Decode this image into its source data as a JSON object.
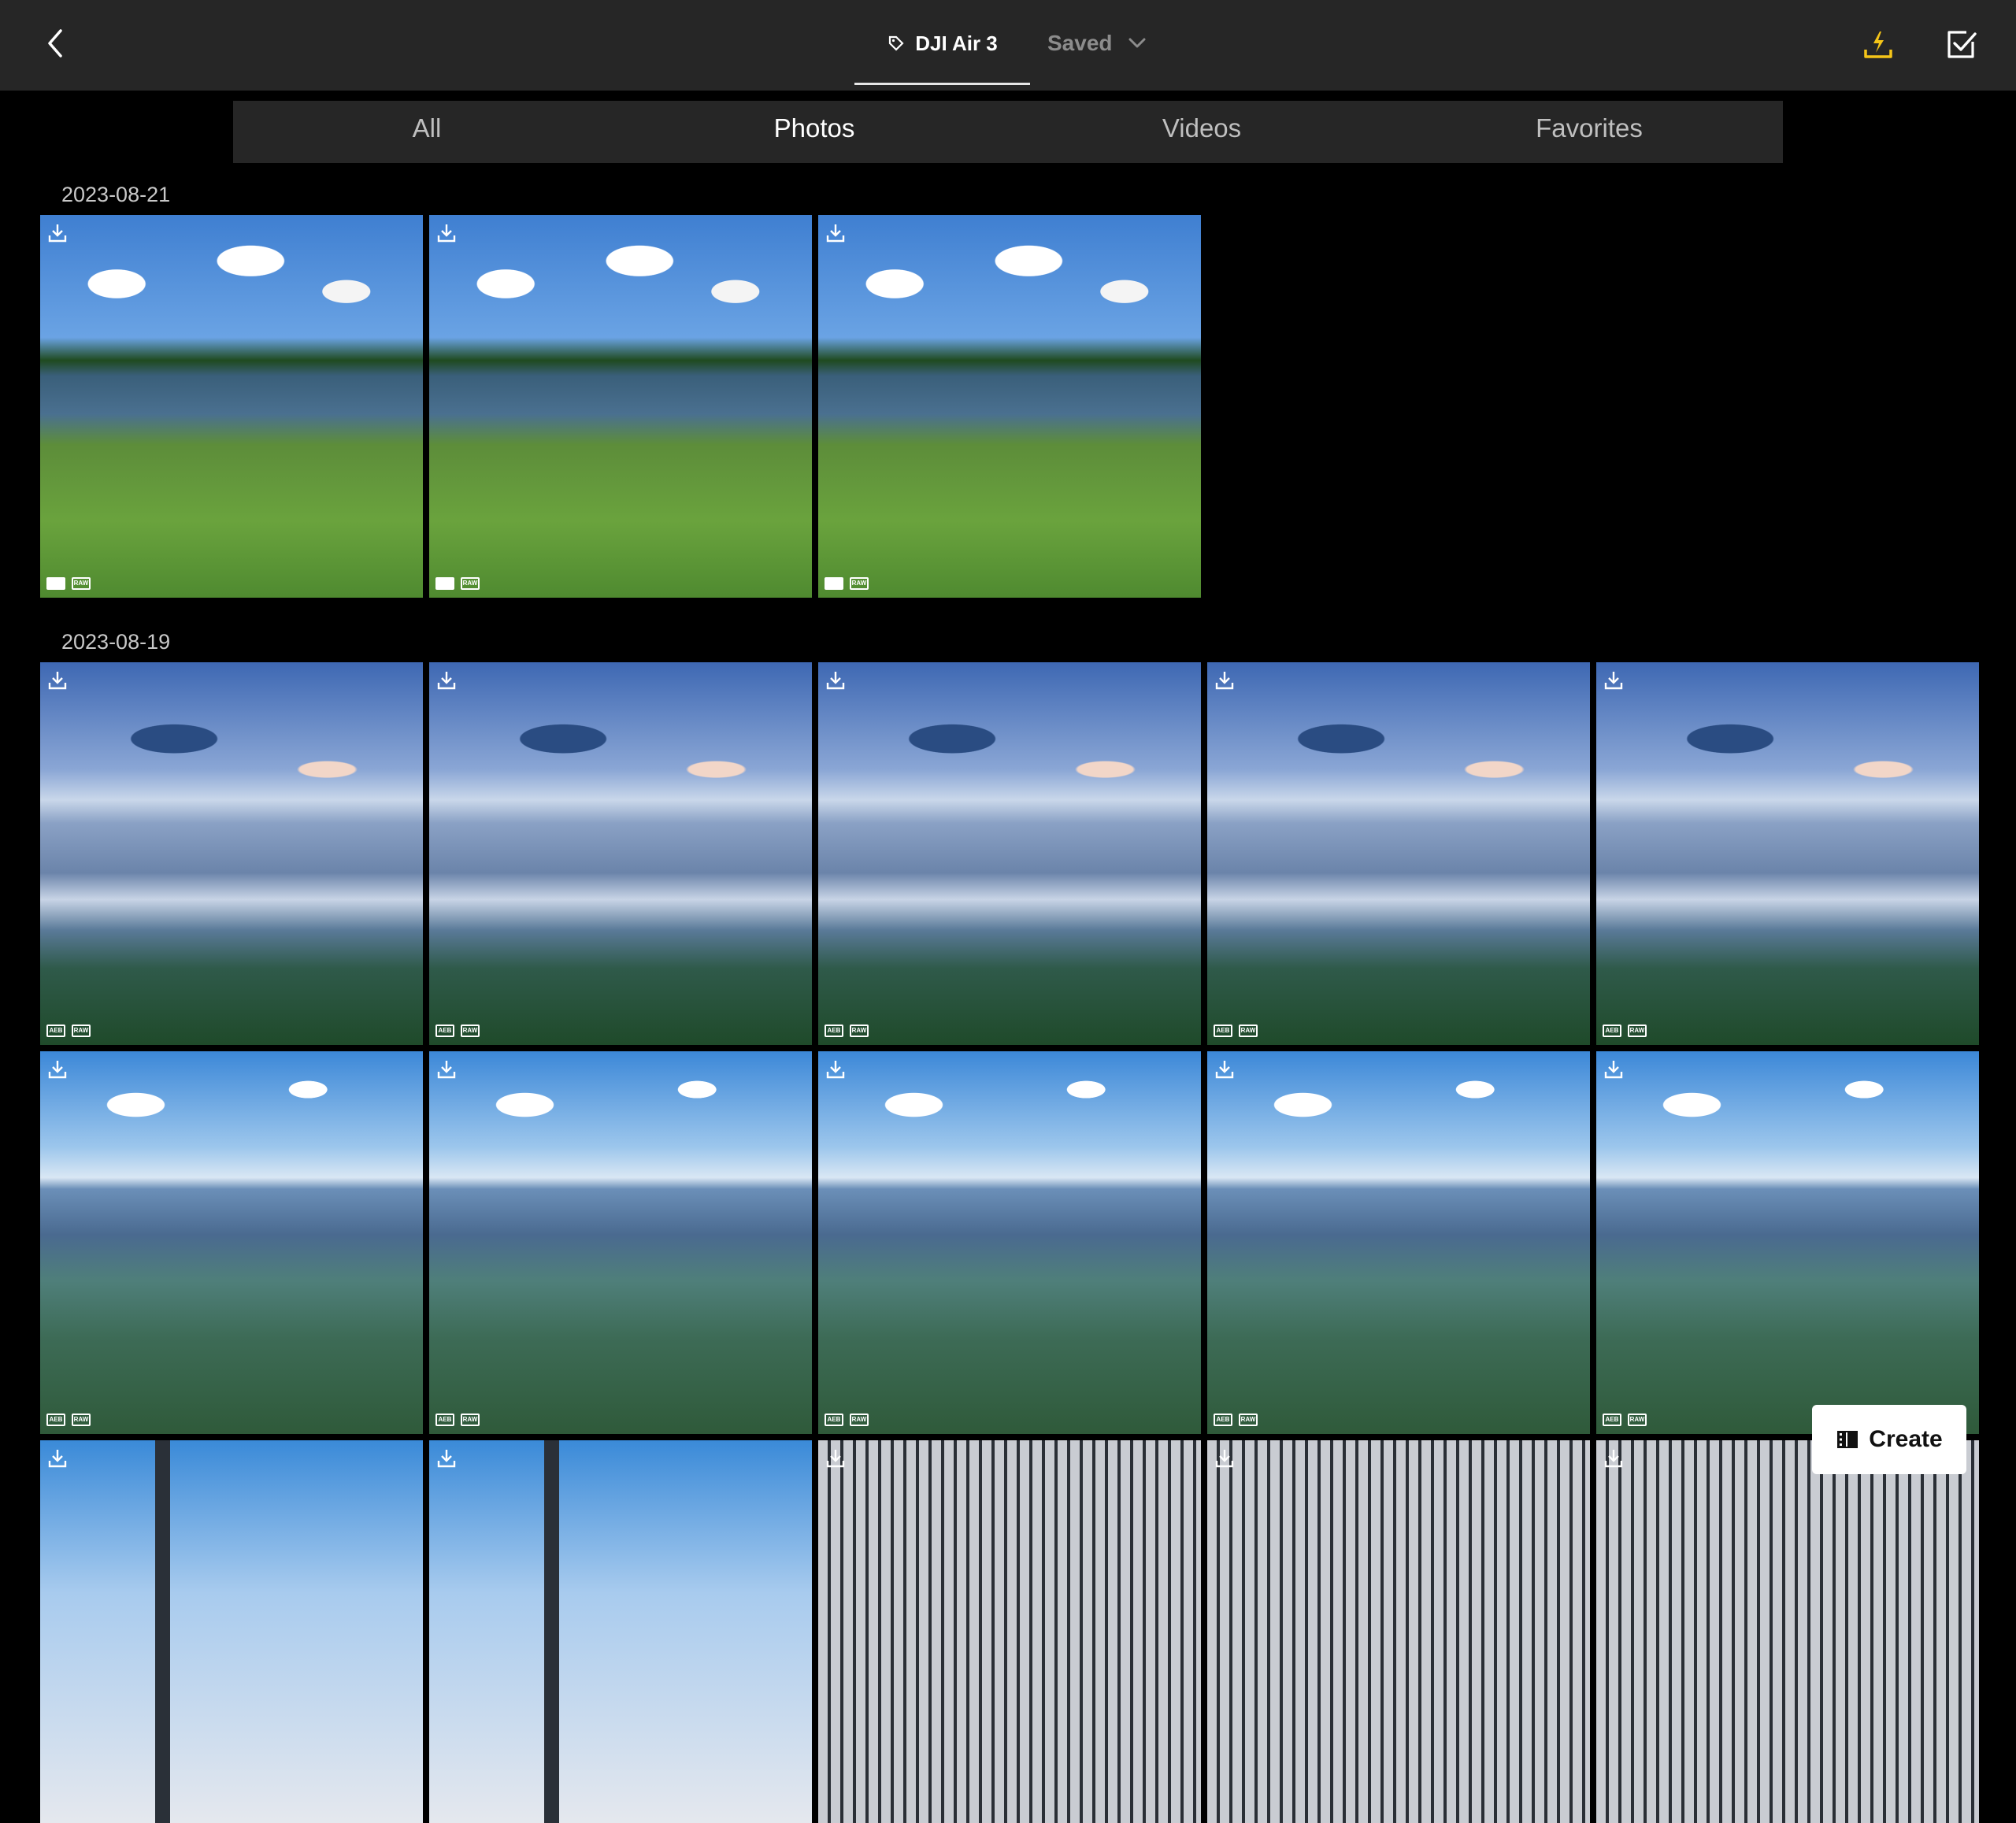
{
  "header": {
    "device_name": "DJI Air 3",
    "saved_label": "Saved"
  },
  "filters": [
    {
      "label": "All",
      "active": false
    },
    {
      "label": "Photos",
      "active": true
    },
    {
      "label": "Videos",
      "active": false
    },
    {
      "label": "Favorites",
      "active": false
    }
  ],
  "groups": [
    {
      "date": "2023-08-21",
      "items": [
        {
          "scene": "lake",
          "badges": [
            "single",
            "RAW"
          ]
        },
        {
          "scene": "lake",
          "badges": [
            "single",
            "RAW"
          ]
        },
        {
          "scene": "lake",
          "badges": [
            "single",
            "RAW"
          ]
        }
      ]
    },
    {
      "date": "2023-08-19",
      "items": [
        {
          "scene": "dock",
          "badges": [
            "AEB",
            "RAW"
          ]
        },
        {
          "scene": "dock",
          "badges": [
            "AEB",
            "RAW"
          ]
        },
        {
          "scene": "dock",
          "badges": [
            "AEB",
            "RAW"
          ]
        },
        {
          "scene": "dock",
          "badges": [
            "AEB",
            "RAW"
          ]
        },
        {
          "scene": "dock",
          "badges": [
            "AEB",
            "RAW"
          ]
        },
        {
          "scene": "pier",
          "badges": [
            "AEB",
            "RAW"
          ]
        },
        {
          "scene": "pier",
          "badges": [
            "AEB",
            "RAW"
          ]
        },
        {
          "scene": "pier",
          "badges": [
            "AEB",
            "RAW"
          ]
        },
        {
          "scene": "pier",
          "badges": [
            "AEB",
            "RAW"
          ]
        },
        {
          "scene": "pier",
          "badges": [
            "AEB",
            "RAW"
          ]
        },
        {
          "scene": "city",
          "badges": []
        },
        {
          "scene": "city",
          "badges": []
        },
        {
          "scene": "building",
          "badges": []
        },
        {
          "scene": "building",
          "badges": []
        },
        {
          "scene": "building",
          "badges": []
        }
      ]
    }
  ],
  "create_button": {
    "label": "Create"
  },
  "colors": {
    "accent_download": "#f5c518",
    "topbar": "#262626",
    "filterbar": "#262626"
  },
  "icons": {
    "back": "chevron-left-icon",
    "device": "drone-tag-icon",
    "saved_dropdown": "chevron-down-icon",
    "download_all": "flash-download-icon",
    "select": "checkbox-icon",
    "thumb_download": "download-icon",
    "create": "film-icon"
  }
}
